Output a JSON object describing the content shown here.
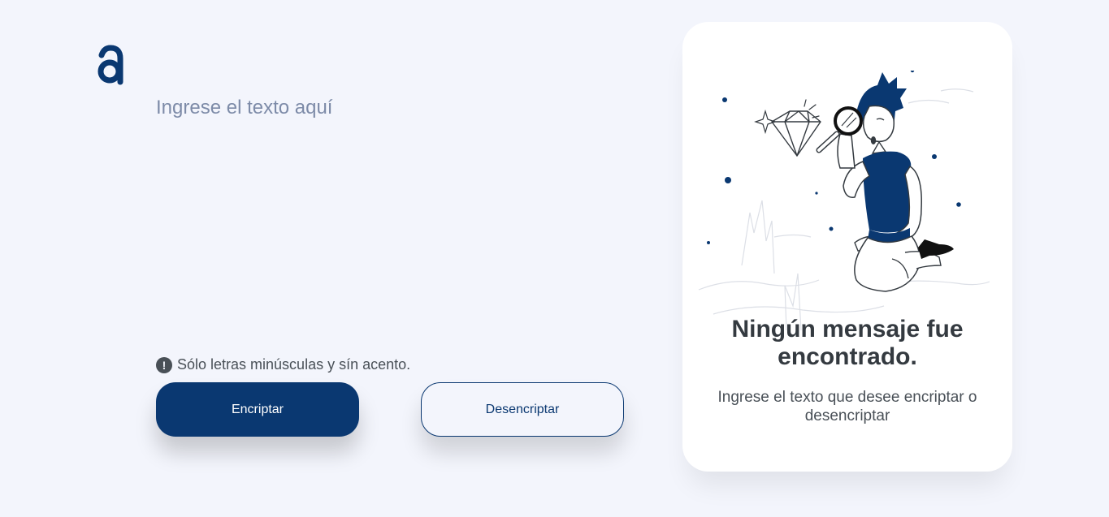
{
  "logo": {
    "icon": "alura-logo-icon"
  },
  "input": {
    "placeholder": "Ingrese el texto aquí",
    "value": ""
  },
  "hint": {
    "icon": "exclamation-circle-icon",
    "text": "Sólo letras minúsculas y sín acento."
  },
  "buttons": {
    "encrypt_label": "Encriptar",
    "decrypt_label": "Desencriptar"
  },
  "output": {
    "illustration": "person-with-magnifying-glass",
    "title": "Ningún mensaje fue encontrado.",
    "text": "Ingrese el texto que desee encriptar o desencriptar"
  },
  "colors": {
    "primary": "#0a3871",
    "background": "#f3f5fc",
    "card": "#ffffff",
    "heading": "#343a40"
  }
}
